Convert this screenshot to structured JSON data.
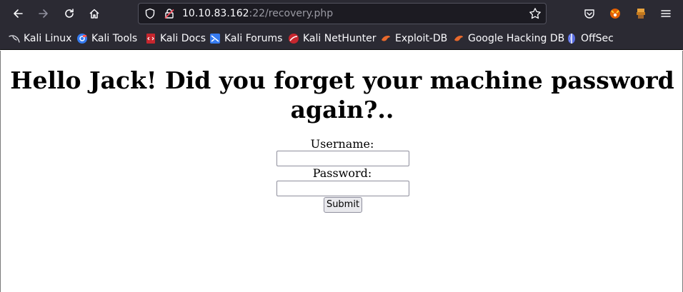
{
  "browser": {
    "url_host": "10.10.83.162",
    "url_rest": ":22/recovery.php"
  },
  "bookmarks": [
    {
      "label": "Kali Linux",
      "icon": "kali-dragon-icon"
    },
    {
      "label": "Kali Tools",
      "icon": "kali-tools-icon"
    },
    {
      "label": "Kali Docs",
      "icon": "kali-docs-icon"
    },
    {
      "label": "Kali Forums",
      "icon": "kali-forums-icon"
    },
    {
      "label": "Kali NetHunter",
      "icon": "kali-nethunter-icon"
    },
    {
      "label": "Exploit-DB",
      "icon": "exploit-db-icon"
    },
    {
      "label": "Google Hacking DB",
      "icon": "ghdb-icon"
    },
    {
      "label": "OffSec",
      "icon": "offsec-icon"
    }
  ],
  "page": {
    "heading": "Hello Jack! Did you forget your machine password again?..",
    "username_label": "Username:",
    "username_value": "",
    "password_label": "Password:",
    "password_value": "",
    "submit_label": "Submit"
  },
  "colors": {
    "toolbar_bg": "#2b2a33",
    "urlbar_bg": "#1c1b22",
    "page_bg": "#ffffff"
  }
}
